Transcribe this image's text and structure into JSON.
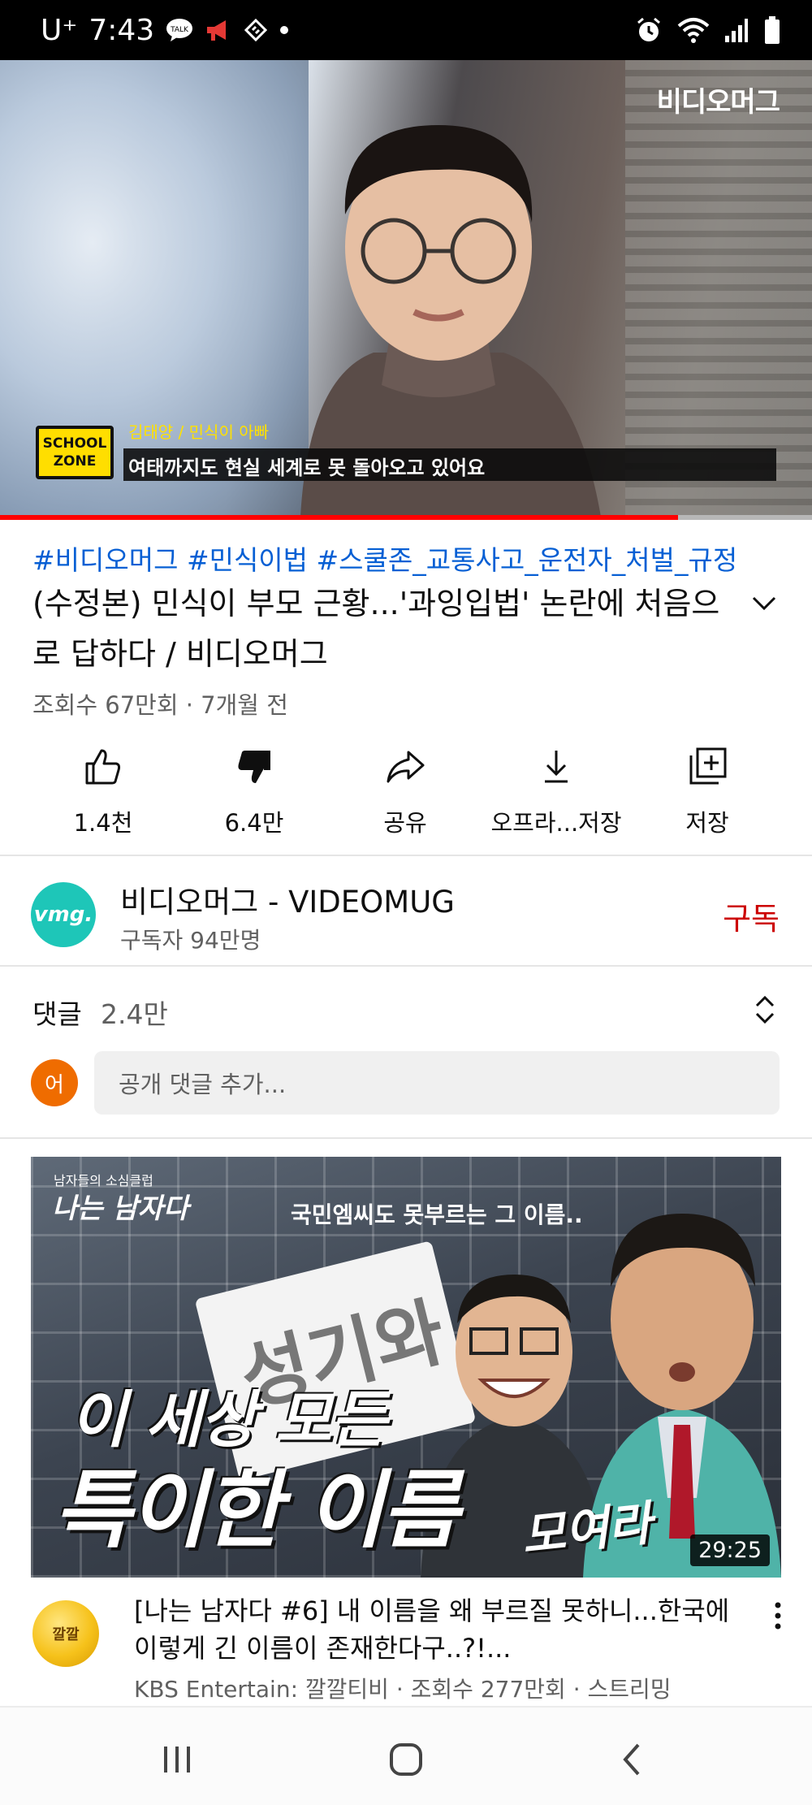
{
  "status_bar": {
    "carrier": "U⁺",
    "time": "7:43",
    "left_icons": [
      "talk-icon",
      "megaphone-icon",
      "network-icon",
      "dot-icon"
    ],
    "right_icons": [
      "alarm-icon",
      "wifi-icon",
      "signal-icon",
      "battery-icon"
    ]
  },
  "player": {
    "watermark": "비디오머그",
    "school_zone": [
      "SCHOOL",
      "ZONE"
    ],
    "caption_name": "김태양 / 민식이 아빠",
    "caption_text": "여태까지도 현실 세계로 못 돌아오고 있어요",
    "progress_fraction": 0.835,
    "colors": {
      "progress": "#ff0000",
      "track": "#b7b7b7"
    }
  },
  "video": {
    "hashtags": "#비디오머그 #민식이법 #스쿨존_교통사고_운전자_처벌_규정",
    "title": "(수정본) 민식이 부모 근황...'과잉입법' 논란에 처음으로 답하다 / 비디오머그",
    "views": "조회수 67만회 · 7개월 전"
  },
  "actions": [
    {
      "label": "1.4천",
      "icon": "thumbs-up-icon"
    },
    {
      "label": "6.4만",
      "icon": "thumbs-down-icon"
    },
    {
      "label": "공유",
      "icon": "share-icon"
    },
    {
      "label": "오프라...저장",
      "icon": "download-icon"
    },
    {
      "label": "저장",
      "icon": "playlist-add-icon"
    }
  ],
  "channel": {
    "avatar_text": "vmg.",
    "name": "비디오머그 - VIDEOMUG",
    "subscribers": "구독자 94만명",
    "subscribe_label": "구독",
    "colors": {
      "avatar": "#1ec6b8",
      "subscribe": "#cc0000"
    }
  },
  "comments": {
    "title": "댓글",
    "count": "2.4만",
    "avatar_text": "어",
    "placeholder": "공개 댓글 추가..."
  },
  "next_video": {
    "thumb_small": "남자들의 소심클럽",
    "thumb_logo": "나는 남자다",
    "thumb_top": "국민엠씨도 못부르는 그 이름..",
    "thumb_sign": "성기와",
    "thumb_line1": "이 세상 모든",
    "thumb_line2": "특이한 이름",
    "thumb_line3": "모여라",
    "duration": "29:25",
    "channel_avatar": "깔깔",
    "title": "[나는 남자다 #6] 내 이름을 왜 부르질 못하니...한국에 이렇게 긴 이름이 존재한다구..?!...",
    "meta": "KBS Entertain: 깔깔티비 · 조회수 277만회 · 스트리밍"
  },
  "nav": [
    "recent-apps-icon",
    "home-icon",
    "back-icon"
  ]
}
